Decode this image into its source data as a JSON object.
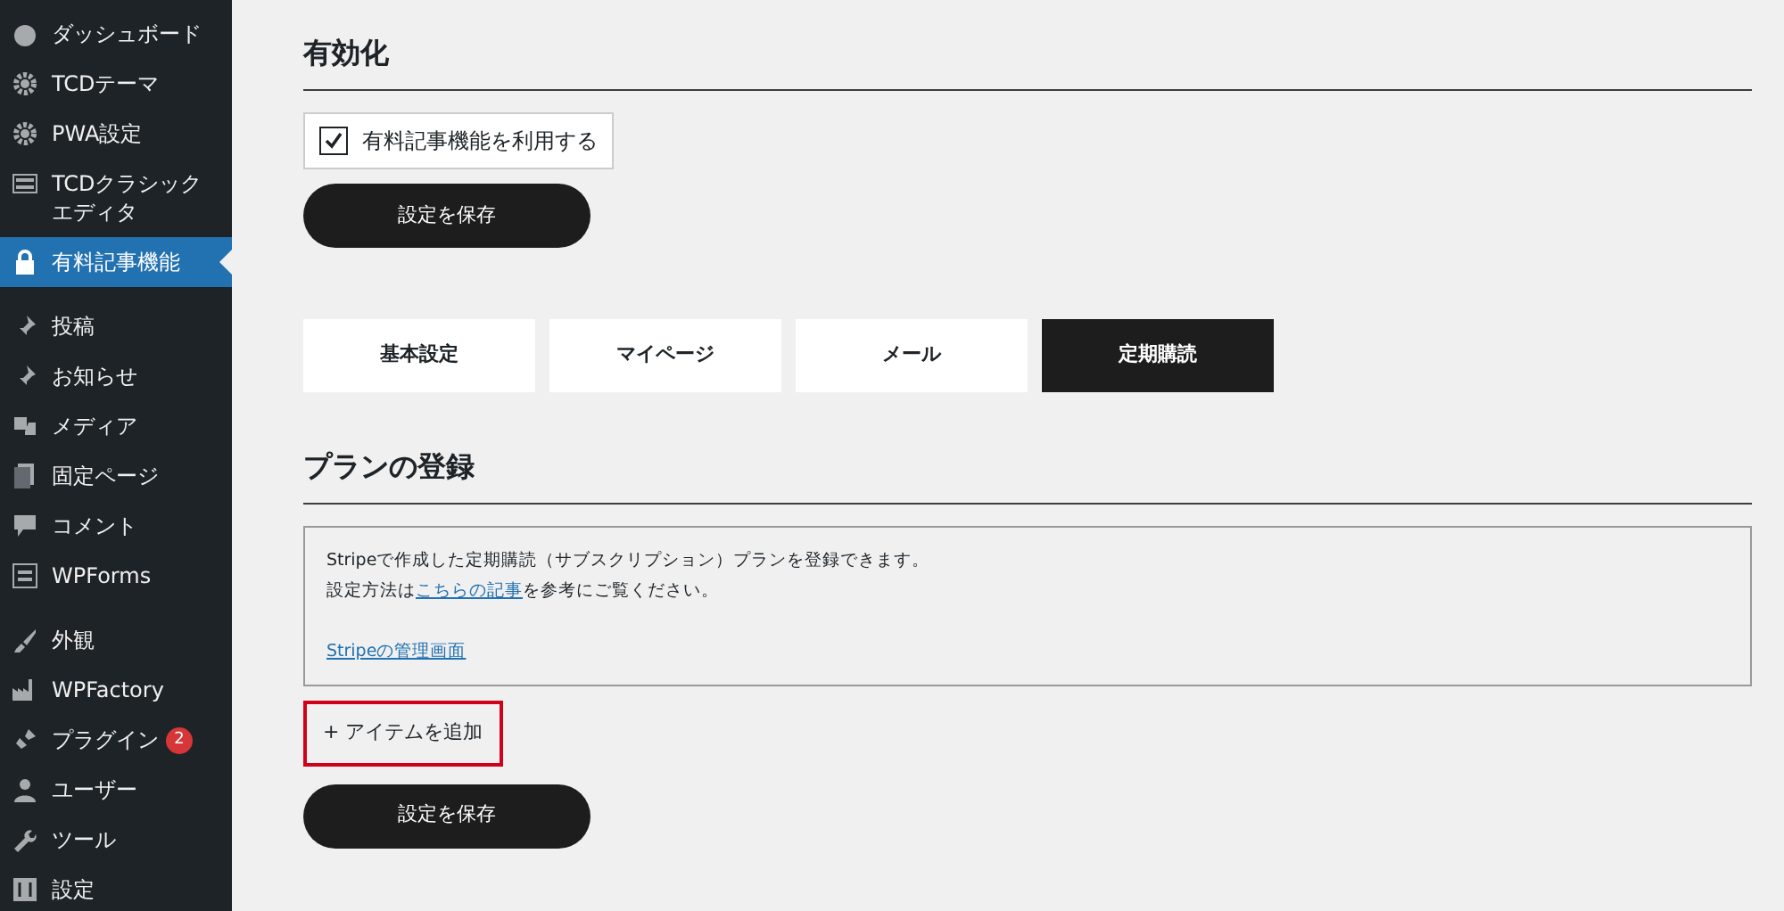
{
  "sidebar": {
    "groups": [
      {
        "items": [
          {
            "label": "ダッシュボード",
            "selected": false
          },
          {
            "label": "TCDテーマ",
            "selected": false
          },
          {
            "label": "PWA設定",
            "selected": false
          },
          {
            "label": "TCDクラシックエディタ",
            "selected": false
          },
          {
            "label": "有料記事機能",
            "selected": true
          }
        ]
      },
      {
        "items": [
          {
            "label": "投稿",
            "selected": false
          },
          {
            "label": "お知らせ",
            "selected": false
          },
          {
            "label": "メディア",
            "selected": false
          },
          {
            "label": "固定ページ",
            "selected": false
          },
          {
            "label": "コメント",
            "selected": false
          },
          {
            "label": "WPForms",
            "selected": false
          }
        ]
      },
      {
        "items": [
          {
            "label": "外観",
            "selected": false
          },
          {
            "label": "WPFactory",
            "selected": false
          },
          {
            "label": "プラグイン",
            "selected": false,
            "badge": "2"
          },
          {
            "label": "ユーザー",
            "selected": false
          },
          {
            "label": "ツール",
            "selected": false
          },
          {
            "label": "設定",
            "selected": false
          }
        ]
      }
    ]
  },
  "enable_section": {
    "heading": "有効化",
    "checkbox": {
      "label": "有料記事機能を利用する",
      "checked": true
    },
    "save_button": "設定を保存"
  },
  "tabs": [
    {
      "label": "基本設定",
      "selected": false
    },
    {
      "label": "マイページ",
      "selected": false
    },
    {
      "label": "メール",
      "selected": false
    },
    {
      "label": "定期購読",
      "selected": true
    }
  ],
  "plan_section": {
    "heading": "プランの登録",
    "description": "Stripeで作成した定期購読（サブスクリプション）プランを登録できます。",
    "guide": {
      "before": "設定方法は",
      "link": "こちらの記事",
      "after": "を参考にご覧ください。"
    },
    "link": "Stripeの管理画面",
    "add_button": "+ アイテムを追加",
    "add_button_highlighted": true,
    "save_button": "設定を保存"
  }
}
